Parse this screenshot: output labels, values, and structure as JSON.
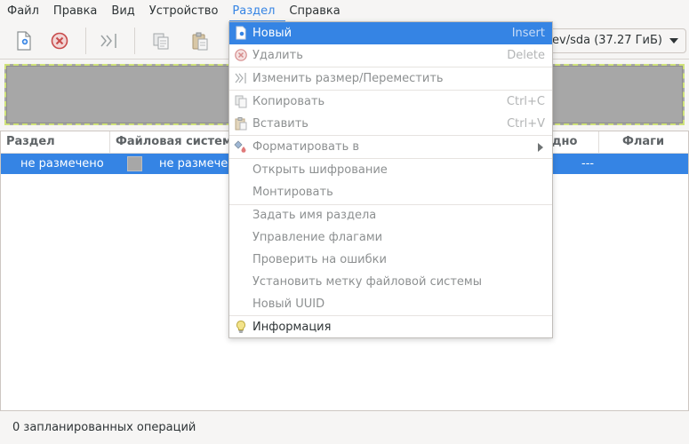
{
  "menubar": {
    "items": [
      "Файл",
      "Правка",
      "Вид",
      "Устройство",
      "Раздел",
      "Справка"
    ],
    "active": "Раздел"
  },
  "toolbar": {
    "buttons": [
      "new-partition-icon",
      "delete-icon",
      "resize-move-icon",
      "copy-icon",
      "paste-icon"
    ]
  },
  "device": {
    "label": "ev/sda (37.27 ГиБ)"
  },
  "table": {
    "headers": [
      "Раздел",
      "Файловая систем",
      "дно",
      "Флаги"
    ],
    "rows": [
      {
        "partition": "не размечено",
        "filesystem": "не размече",
        "used_fragment": "---"
      }
    ]
  },
  "status": {
    "text": "0 запланированных операций"
  },
  "menu": {
    "items": [
      {
        "label": "Новый",
        "accel": "Insert",
        "icon": "new-partition-icon",
        "state": "selected"
      },
      {
        "label": "Удалить",
        "accel": "Delete",
        "icon": "delete-icon",
        "state": "disabled"
      },
      {
        "label": "Изменить размер/Переместить",
        "accel": "",
        "icon": "resize-move-icon",
        "state": "disabled"
      },
      {
        "label": "Копировать",
        "accel": "Ctrl+C",
        "icon": "copy-icon",
        "state": "disabled"
      },
      {
        "label": "Вставить",
        "accel": "Ctrl+V",
        "icon": "paste-icon",
        "state": "disabled"
      },
      {
        "label": "Форматировать в",
        "accel": "",
        "icon": "format-icon",
        "state": "disabled",
        "submenu": true
      },
      {
        "label": "Открыть шифрование",
        "accel": "",
        "state": "disabled"
      },
      {
        "label": "Монтировать",
        "accel": "",
        "state": "disabled"
      },
      {
        "label": "Задать имя раздела",
        "accel": "",
        "state": "disabled"
      },
      {
        "label": "Управление флагами",
        "accel": "",
        "state": "disabled"
      },
      {
        "label": "Проверить на ошибки",
        "accel": "",
        "state": "disabled"
      },
      {
        "label": "Установить метку файловой системы",
        "accel": "",
        "state": "disabled"
      },
      {
        "label": "Новый UUID",
        "accel": "",
        "state": "disabled"
      },
      {
        "label": "Информация",
        "accel": "",
        "icon": "info-bulb-icon",
        "state": "enabled"
      }
    ]
  },
  "colors": {
    "accent": "#3584e4",
    "unallocated": "#a7a7a7",
    "selection_border": "#cfe27a"
  }
}
